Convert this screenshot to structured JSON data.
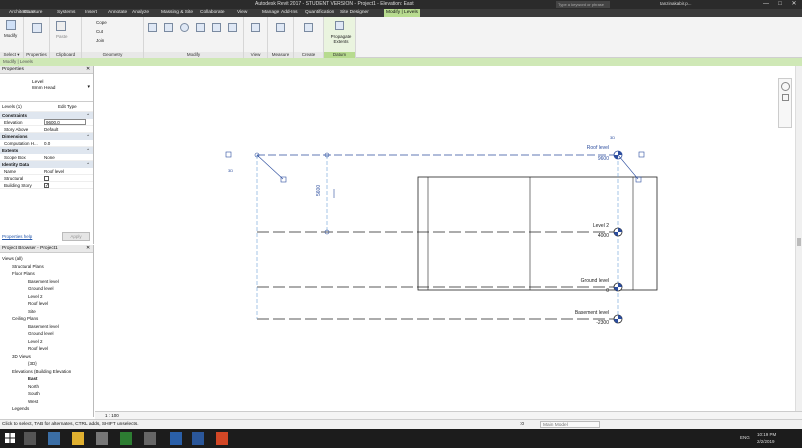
{
  "titlebar": {
    "title": "Autodesk Revit 2017 - STUDENT VERSION -    Project1 - Elevation: East",
    "search_placeholder": "Type a keyword or phrase",
    "user": "tanzinakabir.p...",
    "minimize": "—",
    "maximize": "□",
    "close": "✕"
  },
  "tabs": [
    "Architecture",
    "Structure",
    "Systems",
    "Insert",
    "Annotate",
    "Analyze",
    "Massing & Site",
    "Collaborate",
    "View",
    "Manage",
    "Add-Ins",
    "Quantification",
    "Site Designer",
    "Modify | Levels"
  ],
  "ribbon": {
    "modify": "Modify",
    "select": "Select ▾",
    "properties": "Properties",
    "paste": "Paste",
    "clipboard": "Clipboard",
    "cope": "Cope",
    "cut": "Cut",
    "join": "Join",
    "geometry": "Geometry",
    "modify_group": "Modify",
    "view": "View",
    "measure": "Measure",
    "create": "Create",
    "propagate": "Propagate Extents",
    "datum": "Datum"
  },
  "context_bar": "Modify | Levels",
  "properties": {
    "header": "Properties",
    "type_name": "Level",
    "type_sub": "8mm Head",
    "selector": "Levels (1)",
    "edit_type": "Edit Type",
    "sections": {
      "constraints": "Constraints",
      "dimensions": "Dimensions",
      "extents": "Extents",
      "identity": "Identity Data"
    },
    "elevation_k": "Elevation",
    "elevation_v": "9600.0",
    "story_k": "Story Above",
    "story_v": "Default",
    "comp_k": "Computation H...",
    "comp_v": "0.0",
    "scope_k": "Scope Box",
    "scope_v": "None",
    "name_k": "Name",
    "name_v": "Roof level",
    "structural_k": "Structural",
    "building_k": "Building Story",
    "help": "Properties help",
    "apply": "Apply"
  },
  "browser": {
    "header": "Project Browser - Project1",
    "views": "Views (all)",
    "structural_plans": "Structural Plans",
    "floor_plans": "Floor Plans",
    "fp": [
      "Basement level",
      "Ground level",
      "Level 2",
      "Roof level",
      "Site"
    ],
    "ceiling_plans": "Ceiling Plans",
    "cp": [
      "Basement level",
      "Ground level",
      "Level 2",
      "Roof level"
    ],
    "views_3d": "3D Views",
    "v3d": "{3D}",
    "elevations": "Elevations (Building Elevation",
    "el": [
      "East",
      "North",
      "South",
      "West"
    ],
    "legends": "Legends"
  },
  "levels": [
    {
      "name": "Roof level",
      "value": "9600"
    },
    {
      "name": "Level 2",
      "value": "4000"
    },
    {
      "name": "Ground level",
      "value": "0"
    },
    {
      "name": "Basement level",
      "value": "-2300"
    }
  ],
  "canvas": {
    "dim": "5600",
    "label_3d": "3D"
  },
  "viewctl": {
    "scale": "1 : 100"
  },
  "status": {
    "hint": "Click to select, TAB for alternates, CTRL adds, SHIFT unselects.",
    "zero": ":0",
    "model": "Main Model"
  },
  "taskbar": {
    "lang": "ENG",
    "time": "10:19 PM",
    "date": "2/2/2019"
  },
  "colors": {
    "accent_green": "#b7db8f",
    "level_blue": "#2c4d9e",
    "titlebar": "#2b2b2b"
  }
}
